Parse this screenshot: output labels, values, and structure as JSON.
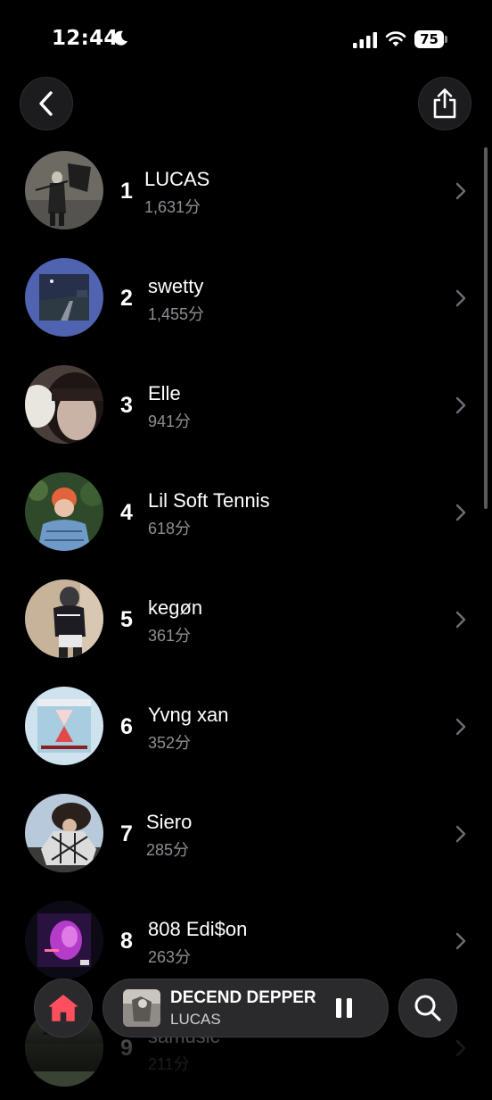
{
  "status_bar": {
    "time": "12:44",
    "battery": "75",
    "icons": [
      "moon-icon",
      "signal-icon",
      "wifi-icon",
      "battery-icon"
    ]
  },
  "header": {
    "back_icon": "chevron-left-icon",
    "share_icon": "share-icon"
  },
  "artists": [
    {
      "rank": "1",
      "name": "LUCAS",
      "minutes": "1,631分"
    },
    {
      "rank": "2",
      "name": "swetty",
      "minutes": "1,455分"
    },
    {
      "rank": "3",
      "name": "Elle",
      "minutes": "941分"
    },
    {
      "rank": "4",
      "name": "Lil Soft Tennis",
      "minutes": "618分"
    },
    {
      "rank": "5",
      "name": "kegøn",
      "minutes": "361分"
    },
    {
      "rank": "6",
      "name": "Yvng xan",
      "minutes": "352分"
    },
    {
      "rank": "7",
      "name": "Siero",
      "minutes": "285分"
    },
    {
      "rank": "8",
      "name": "808 Edi$on",
      "minutes": "263分"
    },
    {
      "rank": "9",
      "name": "samusic",
      "minutes": "211分"
    }
  ],
  "now_playing": {
    "title": "DECEND DEPPER",
    "artist": "LUCAS",
    "state_icon": "pause-icon"
  },
  "bottom_nav": {
    "home_icon": "home-icon",
    "search_icon": "search-icon",
    "accent_color": "#ff4f5e"
  }
}
